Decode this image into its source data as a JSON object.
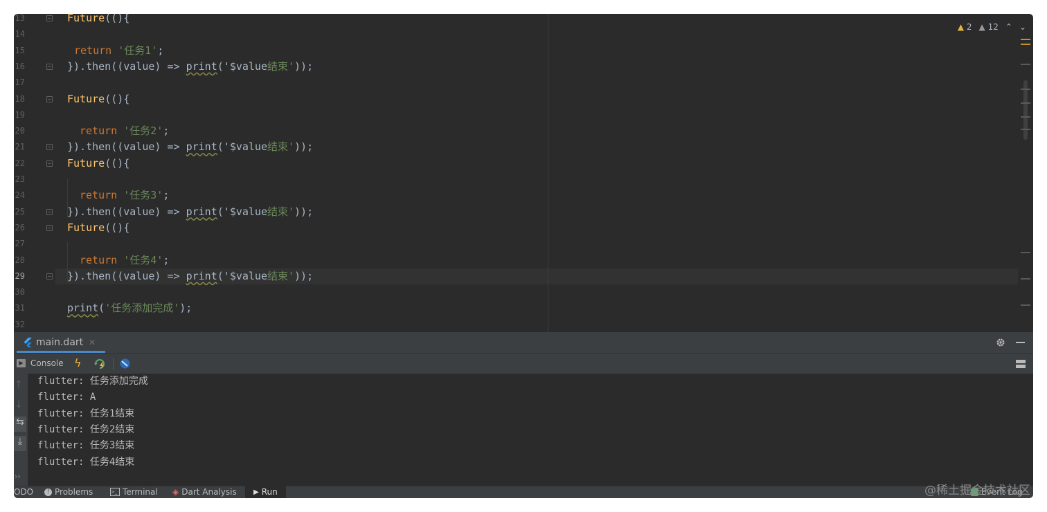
{
  "editor": {
    "line_numbers": [
      "13",
      "14",
      "15",
      "16",
      "17",
      "18",
      "19",
      "20",
      "21",
      "22",
      "23",
      "24",
      "25",
      "26",
      "27",
      "28",
      "29",
      "30",
      "31",
      "32"
    ],
    "lines": [
      {
        "a": "Future",
        "b": "((){"
      },
      {},
      {
        "k": "return",
        "s": "'任务1'",
        "e": ";"
      },
      {
        "p": "}).then((value) => ",
        "f": "print",
        "q": "('",
        "v": "$value",
        "s": "结束'",
        "e": "));"
      },
      {},
      {
        "a": "Future",
        "b": "((){"
      },
      {},
      {
        "k": "return",
        "s": "'任务2'",
        "e": ";"
      },
      {
        "p": "}).then((value) => ",
        "f": "print",
        "q": "('",
        "v": "$value",
        "s": "结束'",
        "e": "));"
      },
      {
        "a": "Future",
        "b": "((){"
      },
      {},
      {
        "k": "return",
        "s": "'任务3'",
        "e": ";"
      },
      {
        "p": "}).then((value) => ",
        "f": "print",
        "q": "('",
        "v": "$value",
        "s": "结束'",
        "e": "));"
      },
      {
        "a": "Future",
        "b": "((){"
      },
      {},
      {
        "k": "return",
        "s": "'任务4'",
        "e": ";"
      },
      {
        "p": "}).then((value) => ",
        "f": "print",
        "q": "('",
        "v": "$value",
        "s": "结束'",
        "e": "));"
      },
      {},
      {
        "f": "print",
        "q": "(",
        "s": "'任务添加完成'",
        "e": ");"
      },
      {}
    ],
    "warnings_count": "2",
    "weak_warnings_count": "12"
  },
  "run_panel": {
    "tab_label": "main.dart",
    "console_label": "Console",
    "output_lines": [
      "flutter: 任务添加完成",
      "flutter: A",
      "flutter: 任务1结束",
      "flutter: 任务2结束",
      "flutter: 任务3结束",
      "flutter: 任务4结束"
    ]
  },
  "status_bar": {
    "todo_label": "ODO",
    "problems_label": "Problems",
    "terminal_label": "Terminal",
    "dart_analysis_label": "Dart Analysis",
    "run_label": "Run",
    "event_log_label": "Event Log"
  },
  "watermark": "@稀土掘金技术社区",
  "colors": {
    "editor_bg": "#2b2b2b",
    "keyword": "#cc7832",
    "string": "#6a8759",
    "function": "#ffc66d",
    "accent": "#4a88c7"
  }
}
